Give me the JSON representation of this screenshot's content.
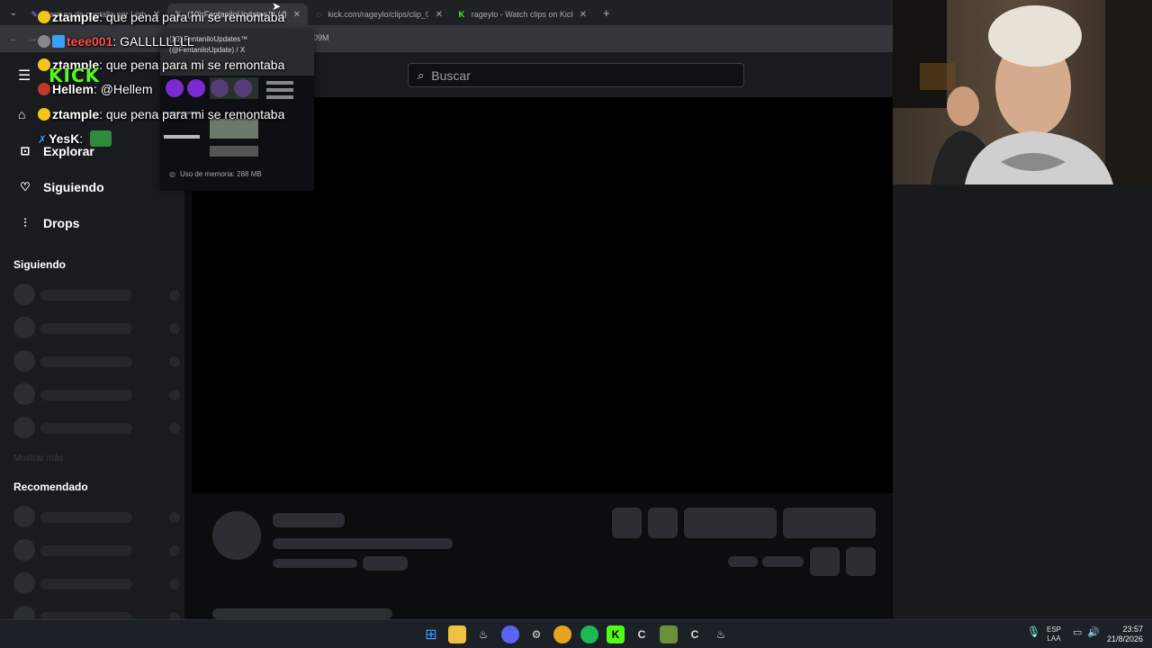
{
  "browser": {
    "tabs": [
      {
        "title": "Captura de pantalla por Lightshot",
        "active": false
      },
      {
        "title": "(10) FentaniloUpdates™ (@Fen...",
        "active": true
      },
      {
        "title": "kick.com/rageylo/clips/clip_01K...",
        "active": false
      },
      {
        "title": "rageylo - Watch clips on Kick",
        "active": false
      }
    ],
    "address_tail": "09M"
  },
  "tab_preview": {
    "title_line1": "(10) FentaniloUpdates™",
    "title_line2": "(@FentaniloUpdate) / X",
    "memory": "Uso de memoria: 288 MB"
  },
  "page": {
    "search_placeholder": "Buscar",
    "nav": {
      "explore": "Explorar",
      "following": "Siguiendo",
      "drops": "Drops"
    },
    "section_following": "Siguiendo",
    "show_more": "Mostrar más",
    "section_recommended": "Recomendado"
  },
  "chat": [
    {
      "user": "ztample",
      "message": ": que pena para mi se remontaba",
      "user_color": "#ffffff"
    },
    {
      "user": "teee001",
      "message": ": GALLLLLLLL",
      "user_color": "#ff4d4d"
    },
    {
      "user": "ztample",
      "message": ": que pena para mi se remontaba",
      "user_color": "#ffffff"
    },
    {
      "user": "Hellem",
      "message": ": @Hellem",
      "user_color": "#ffffff"
    },
    {
      "user": "ztample",
      "message": ": que pena para mi se remontaba",
      "user_color": "#ffffff"
    },
    {
      "user": "YesK",
      "message": ":",
      "user_color": "#ffffff"
    }
  ],
  "overlay_logo": "KICK",
  "taskbar": {
    "lang_line1": "ESP",
    "lang_line2": "LAA",
    "time": "23:57",
    "date": "21/8/2026"
  },
  "colors": {
    "kick_green": "#53fc18",
    "sidebar_bg": "#191b1f",
    "skeleton": "#2b2e33"
  }
}
